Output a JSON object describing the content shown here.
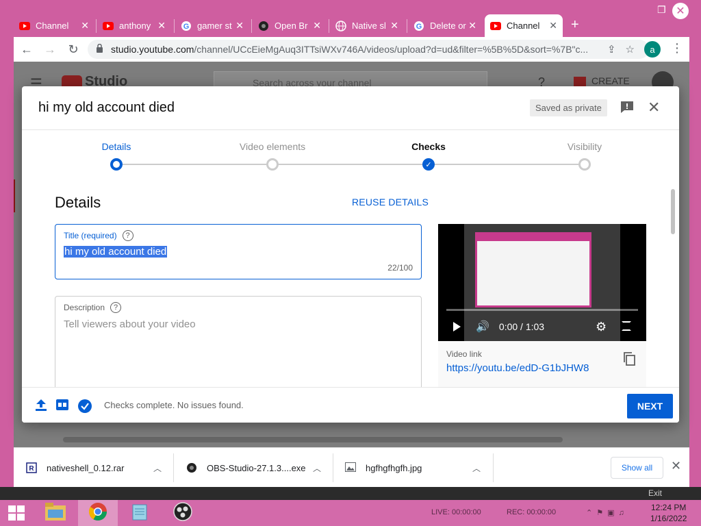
{
  "browser": {
    "tabs": [
      {
        "label": "Channel",
        "icon": "youtube-icon"
      },
      {
        "label": "anthony",
        "icon": "youtube-icon"
      },
      {
        "label": "gamer st",
        "icon": "google-icon"
      },
      {
        "label": "Open Br",
        "icon": "obs-icon"
      },
      {
        "label": "Native sl",
        "icon": "globe-icon"
      },
      {
        "label": "Delete or",
        "icon": "google-icon"
      },
      {
        "label": "Channel",
        "icon": "youtube-icon",
        "active": true
      }
    ],
    "url_host": "studio.youtube.com",
    "url_rest": "/channel/UCcEieMgAuq3ITTsiWXv746A/videos/upload?d=ud&filter=%5B%5D&sort=%7B\"c...",
    "profile_initial": "a"
  },
  "studio": {
    "logo_text": "Studio",
    "search_placeholder": "Search across your channel",
    "create_label": "CREATE"
  },
  "modal": {
    "title": "hi my old account died",
    "saved_badge": "Saved as private",
    "steps": [
      {
        "label": "Details",
        "state": "active"
      },
      {
        "label": "Video elements",
        "state": "pending"
      },
      {
        "label": "Checks",
        "state": "done"
      },
      {
        "label": "Visibility",
        "state": "pending"
      }
    ],
    "section_title": "Details",
    "reuse_label": "REUSE DETAILS",
    "title_field": {
      "label": "Title (required)",
      "value": "hi my old account died",
      "count": "22/100"
    },
    "description_field": {
      "label": "Description",
      "placeholder": "Tell viewers about your video"
    },
    "preview": {
      "time": "0:00 / 1:03",
      "link_label": "Video link",
      "link": "https://youtu.be/edD-G1bJHW8"
    },
    "footer": {
      "status": "Checks complete. No issues found.",
      "next_label": "NEXT"
    }
  },
  "downloads": {
    "items": [
      {
        "name": "nativeshell_0.12.rar",
        "icon": "rar-icon"
      },
      {
        "name": "OBS-Studio-27.1.3....exe",
        "icon": "obs-icon"
      },
      {
        "name": "hgfhgfhgfh.jpg",
        "icon": "image-icon"
      }
    ],
    "show_all_label": "Show all"
  },
  "obs": {
    "exit_label": "Exit",
    "live": "LIVE: 00:00:00",
    "rec": "REC: 00:00:00"
  },
  "taskbar": {
    "time": "12:24 PM",
    "date": "1/16/2022"
  },
  "colors": {
    "accent": "#065fd4",
    "window_frame": "#cf5ea0",
    "taskbar": "#d36aaa"
  }
}
